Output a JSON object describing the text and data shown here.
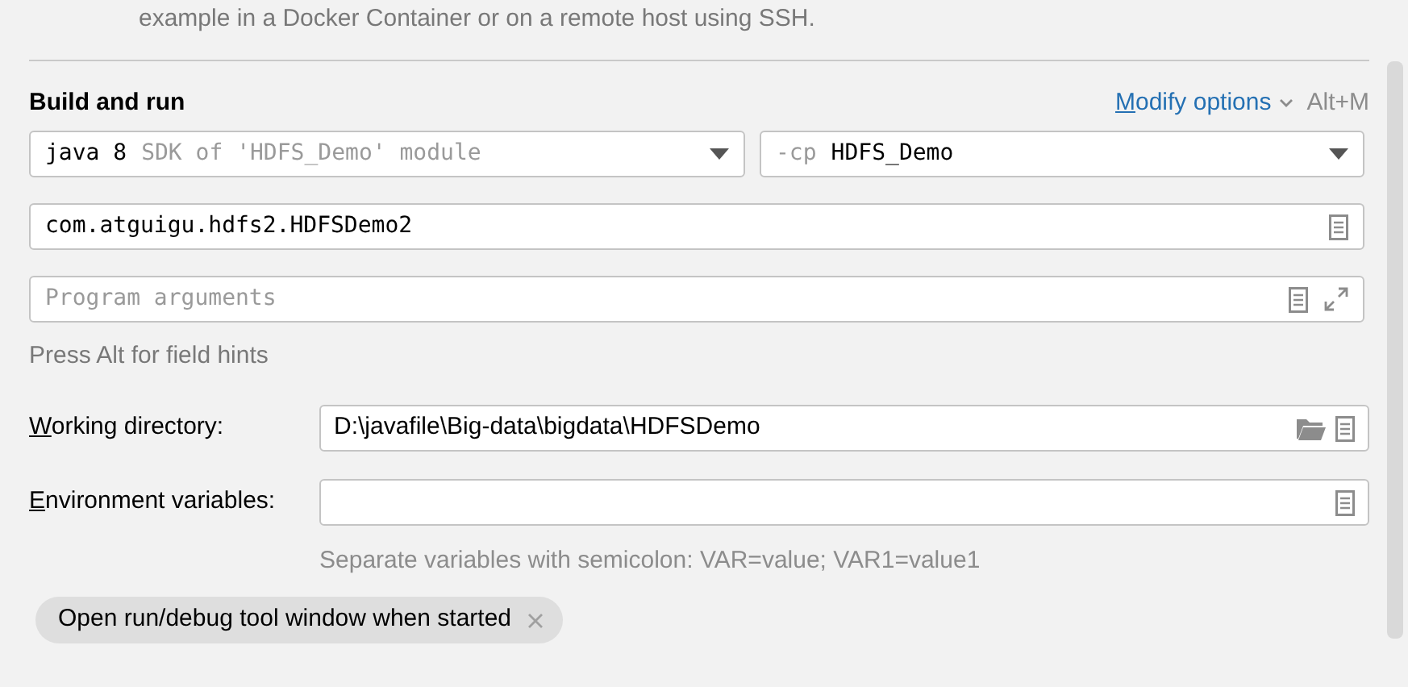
{
  "description": "example in a Docker Container or on a remote host using SSH.",
  "section_title": "Build and run",
  "modify_options": {
    "label": "Modify options",
    "mnemonic_first": true,
    "shortcut": "Alt+M"
  },
  "jre_select": {
    "value": "java 8",
    "hint": "SDK of 'HDFS_Demo' module"
  },
  "classpath_select": {
    "prefix": "-cp",
    "value": "HDFS_Demo"
  },
  "main_class": {
    "value": "com.atguigu.hdfs2.HDFSDemo2"
  },
  "program_arguments": {
    "placeholder": "Program arguments"
  },
  "field_hint": "Press Alt for field hints",
  "working_directory": {
    "label": "Working directory:",
    "mnemonic_first": true,
    "value": "D:\\javafile\\Big-data\\bigdata\\HDFSDemo"
  },
  "environment_variables": {
    "label": "Environment variables:",
    "mnemonic_first": true,
    "hint": "Separate variables with semicolon: VAR=value; VAR1=value1"
  },
  "tag": {
    "label": "Open run/debug tool window when started"
  }
}
